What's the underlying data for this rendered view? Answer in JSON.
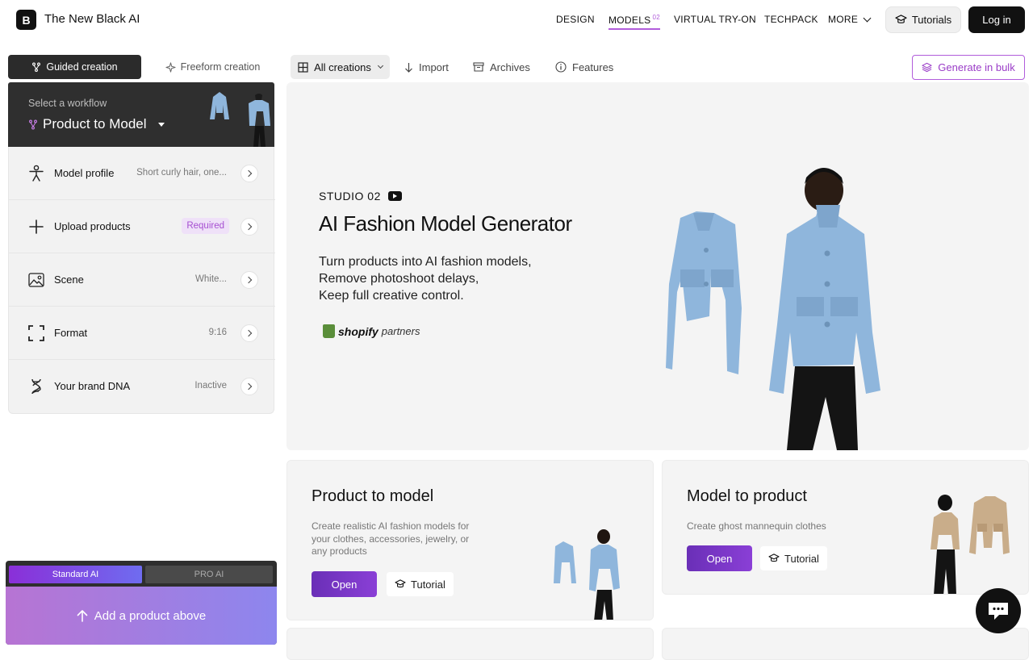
{
  "brand": {
    "logo_letter": "B",
    "name": "The New Black AI"
  },
  "nav": {
    "links": [
      "DESIGN",
      "MODELS",
      "VIRTUAL TRY-ON",
      "TECHPACK",
      "MORE"
    ],
    "models_badge": "02",
    "tutorials": "Tutorials",
    "login": "Log in"
  },
  "sidebar": {
    "tabs": {
      "guided": "Guided creation",
      "freeform": "Freeform creation"
    },
    "workflow": {
      "caption": "Select a workflow",
      "selected": "Product to Model"
    },
    "steps": [
      {
        "label": "Model profile",
        "value": "Short curly hair, one..."
      },
      {
        "label": "Upload products",
        "badge": "Required"
      },
      {
        "label": "Scene",
        "value": "White..."
      },
      {
        "label": "Format",
        "value": "9:16"
      },
      {
        "label": "Your brand DNA",
        "value": "Inactive"
      }
    ],
    "ai_tabs": {
      "standard": "Standard AI",
      "pro": "PRO AI"
    },
    "cta": "Add a product above"
  },
  "toolbar": {
    "all_creations": "All creations",
    "import": "Import",
    "archives": "Archives",
    "features": "Features",
    "bulk": "Generate in bulk"
  },
  "hero": {
    "studio": "STUDIO 02",
    "title": "AI Fashion Model Generator",
    "lines": [
      "Turn products into AI fashion models,",
      "Remove photoshoot delays,",
      "Keep full creative control."
    ],
    "partner_word": "shopify",
    "partner_suffix": "partners"
  },
  "cards": [
    {
      "title": "Product to model",
      "desc": "Create realistic AI fashion models for your clothes, accessories, jewelry, or any products",
      "open": "Open",
      "tutorial": "Tutorial"
    },
    {
      "title": "Model to product",
      "desc": "Create ghost mannequin clothes",
      "open": "Open",
      "tutorial": "Tutorial"
    }
  ],
  "colors": {
    "accent": "#b15cdb",
    "jacket_blue": "#8fb6dc",
    "beige": "#c9ad8a"
  }
}
